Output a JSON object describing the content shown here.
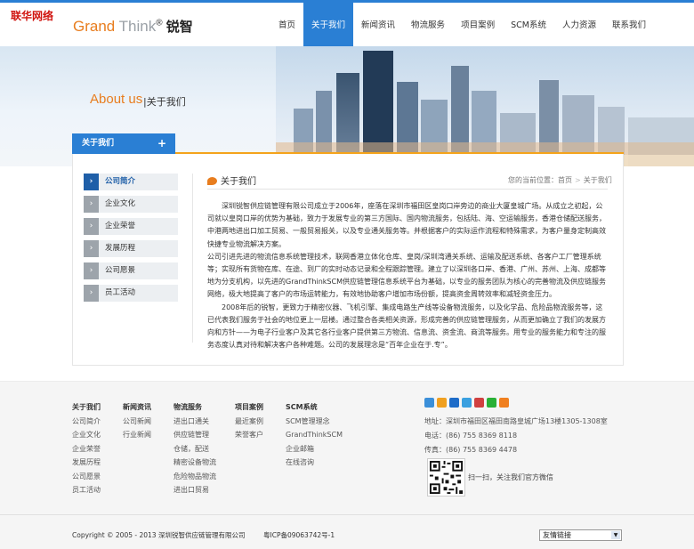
{
  "watermark": "联华网络",
  "logo": {
    "grand": "Grand",
    "think": " Think",
    "reg": "®",
    "cn": " 锐智"
  },
  "nav": [
    "首页",
    "关于我们",
    "新闻资讯",
    "物流服务",
    "项目案例",
    "SCM系统",
    "人力资源",
    "联系我们"
  ],
  "nav_active": 1,
  "banner": {
    "about_en": "About us",
    "about_cn": "|关于我们"
  },
  "sidenav": {
    "title": "关于我们",
    "plus": "+"
  },
  "side_items": [
    "公司简介",
    "企业文化",
    "企业荣誉",
    "发展历程",
    "公司愿景",
    "员工活动"
  ],
  "side_active": 0,
  "article": {
    "title": "关于我们",
    "crumb_label": "您的当前位置：",
    "crumb_home": "首页",
    "crumb_sep": ">",
    "crumb_current": "关于我们",
    "paragraphs": [
      "　　深圳锐智供应链管理有限公司成立于2006年，座落在深圳市福田区皇岗口岸旁边的商业大厦皇城广场。从成立之初起，公司就以皇岗口岸的优势为基础，致力于发展专业的第三方国际、国内物流服务，包括陆、海、空运输服务，香港仓储配送服务，中港两地进出口加工贸易、一般贸易报关，以及专业通关服务等。并根据客户的实际运作流程和特殊需求，为客户量身定制高效快捷专业物流解决方案。",
      "公司引进先进的物流信息系统管理技术，联网香港立体化仓库、皇岗/深圳湾通关系统、运输及配送系统、各客户工厂管理系统等；实现所有货物在库、在途、到厂的实时动态记录和全程跟踪管理。建立了以深圳各口岸、香港、广州、苏州、上海、成都等地为分支机构，以先进的GrandThinkSCM供应链管理信息系统平台为基础，以专业的服务团队为核心的完善物流及供应链服务网络，极大地提高了客户的市场运转能力，有效地协助客户增加市场份额，提高资金周转效率和减轻资金压力。",
      "　　2008年后的锐智，更致力于精密仪器、飞机引擎、集成电路生产线等设备物流服务，以及化学品、危险品物流服务等，这已代表我们服务于社会的地位更上一层楼。通过整合各类相关资源，形成完善的供应链管理服务，从而更加确立了我们的发展方向和方针——为电子行业客户及其它各行业客户提供第三方物流、信息流、资金流、商流等服务。用专业的服务能力和专注的服务态度认真对待和解决客户各种难题。公司的发展理念是“百年企业在于.专”。"
    ]
  },
  "footer": {
    "columns": [
      {
        "title": "关于我们",
        "links": [
          "公司简介",
          "企业文化",
          "企业荣誉",
          "发展历程",
          "公司愿景",
          "员工活动"
        ]
      },
      {
        "title": "新闻资讯",
        "links": [
          "公司新闻",
          "行业新闻"
        ]
      },
      {
        "title": "物流服务",
        "links": [
          "进出口通关",
          "供应链管理",
          "仓储，配送",
          "精密设备物流",
          "危险物品物流",
          "进出口贸易"
        ]
      },
      {
        "title": "项目案例",
        "links": [
          "最近案例",
          "荣誉客户"
        ]
      },
      {
        "title": "SCM系统",
        "links": [
          "SCM管理理念",
          "GrandThinkSCM",
          "企业邮箱",
          "在线咨询"
        ]
      }
    ],
    "address": "地址：深圳市福田区福田南路皇城广场13楼1305-1308室",
    "phone": "电话：(86) 755 8369 8118",
    "fax": "传真：(86) 755 8369 4478",
    "qr_text": "扫一扫，关注我们官方微信",
    "share_colors": [
      "#3b8fd9",
      "#f0a020",
      "#1e6cc8",
      "#3aa0e0",
      "#d04040",
      "#29b036",
      "#f08020"
    ],
    "copyright": "Copyright © 2005 - 2013 深圳锐智供应链管理有限公司",
    "icp": "粤ICP备09063742号-1",
    "friend_links": "友情链接"
  }
}
